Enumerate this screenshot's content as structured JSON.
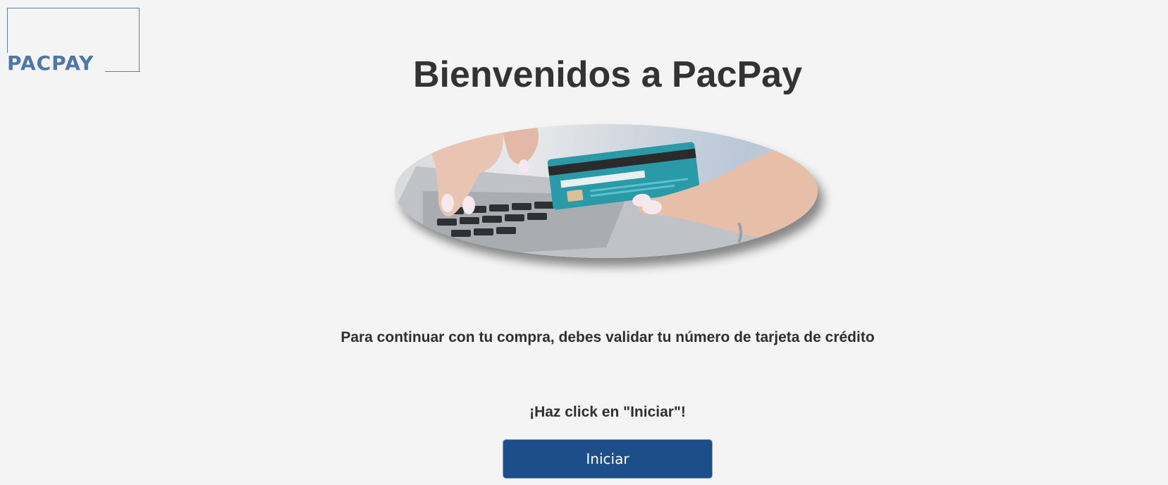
{
  "brand": {
    "logo_text": "PACPAY",
    "accent_color": "#4d77a8"
  },
  "header": {
    "title": "Bienvenidos a PacPay"
  },
  "hero": {
    "image_subject": "hands-typing-laptop-holding-credit-card"
  },
  "main": {
    "instruction": "Para continuar con tu compra, debes validar tu número de tarjeta de crédito",
    "cta_hint": "¡Haz click en \"Iniciar\"!",
    "start_button_label": "Iniciar",
    "button_color": "#1d4e89"
  }
}
